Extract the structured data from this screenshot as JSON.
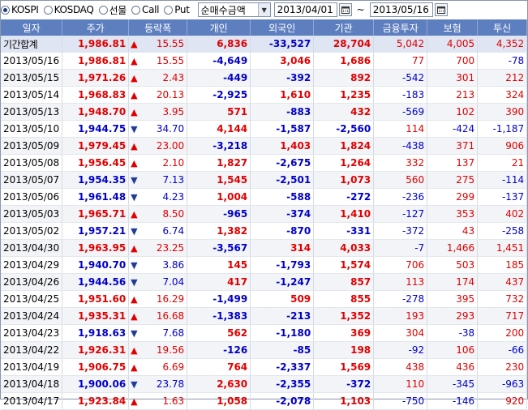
{
  "toolbar": {
    "radios": [
      {
        "label": "KOSPI",
        "selected": true
      },
      {
        "label": "KOSDAQ",
        "selected": false
      },
      {
        "label": "선물",
        "selected": false
      },
      {
        "label": "Call",
        "selected": false
      },
      {
        "label": "Put",
        "selected": false
      }
    ],
    "metric_select": "순매수금액",
    "date_from": "2013/04/01",
    "date_separator": "~",
    "date_to": "2013/05/16"
  },
  "colors": {
    "up": "#e00000",
    "down": "#0000c8",
    "header": "#5e7fbf"
  },
  "table": {
    "headers": [
      "일자",
      "주가",
      "등락폭",
      "개인",
      "외국인",
      "기관",
      "금융투자",
      "보험",
      "투신"
    ],
    "rows": [
      {
        "date": "기간합계",
        "price": "1,986.81",
        "dir": "up",
        "chg": "15.55",
        "ind": "6,836",
        "frn": "-33,527",
        "inst": "28,704",
        "fin": "5,042",
        "ins": "4,005",
        "trust": "4,352"
      },
      {
        "date": "2013/05/16",
        "price": "1,986.81",
        "dir": "up",
        "chg": "15.55",
        "ind": "-4,649",
        "frn": "3,046",
        "inst": "1,686",
        "fin": "77",
        "ins": "700",
        "trust": "-78"
      },
      {
        "date": "2013/05/15",
        "price": "1,971.26",
        "dir": "up",
        "chg": "2.43",
        "ind": "-449",
        "frn": "-392",
        "inst": "892",
        "fin": "-542",
        "ins": "301",
        "trust": "212"
      },
      {
        "date": "2013/05/14",
        "price": "1,968.83",
        "dir": "up",
        "chg": "20.13",
        "ind": "-2,925",
        "frn": "1,610",
        "inst": "1,235",
        "fin": "-183",
        "ins": "213",
        "trust": "324"
      },
      {
        "date": "2013/05/13",
        "price": "1,948.70",
        "dir": "up",
        "chg": "3.95",
        "ind": "571",
        "frn": "-883",
        "inst": "432",
        "fin": "-569",
        "ins": "102",
        "trust": "390"
      },
      {
        "date": "2013/05/10",
        "price": "1,944.75",
        "dir": "down",
        "chg": "34.70",
        "ind": "4,144",
        "frn": "-1,587",
        "inst": "-2,560",
        "fin": "114",
        "ins": "-424",
        "trust": "-1,187"
      },
      {
        "date": "2013/05/09",
        "price": "1,979.45",
        "dir": "up",
        "chg": "23.00",
        "ind": "-3,218",
        "frn": "1,403",
        "inst": "1,824",
        "fin": "-438",
        "ins": "371",
        "trust": "906"
      },
      {
        "date": "2013/05/08",
        "price": "1,956.45",
        "dir": "up",
        "chg": "2.10",
        "ind": "1,827",
        "frn": "-2,675",
        "inst": "1,264",
        "fin": "332",
        "ins": "137",
        "trust": "21"
      },
      {
        "date": "2013/05/07",
        "price": "1,954.35",
        "dir": "down",
        "chg": "7.13",
        "ind": "1,545",
        "frn": "-2,501",
        "inst": "1,073",
        "fin": "560",
        "ins": "275",
        "trust": "-114"
      },
      {
        "date": "2013/05/06",
        "price": "1,961.48",
        "dir": "down",
        "chg": "4.23",
        "ind": "1,004",
        "frn": "-588",
        "inst": "-272",
        "fin": "-236",
        "ins": "299",
        "trust": "-137"
      },
      {
        "date": "2013/05/03",
        "price": "1,965.71",
        "dir": "up",
        "chg": "8.50",
        "ind": "-965",
        "frn": "-374",
        "inst": "1,410",
        "fin": "-127",
        "ins": "353",
        "trust": "402"
      },
      {
        "date": "2013/05/02",
        "price": "1,957.21",
        "dir": "down",
        "chg": "6.74",
        "ind": "1,382",
        "frn": "-870",
        "inst": "-331",
        "fin": "-372",
        "ins": "43",
        "trust": "-258"
      },
      {
        "date": "2013/04/30",
        "price": "1,963.95",
        "dir": "up",
        "chg": "23.25",
        "ind": "-3,567",
        "frn": "314",
        "inst": "4,033",
        "fin": "-7",
        "ins": "1,466",
        "trust": "1,451"
      },
      {
        "date": "2013/04/29",
        "price": "1,940.70",
        "dir": "down",
        "chg": "3.86",
        "ind": "145",
        "frn": "-1,793",
        "inst": "1,574",
        "fin": "706",
        "ins": "503",
        "trust": "185"
      },
      {
        "date": "2013/04/26",
        "price": "1,944.56",
        "dir": "down",
        "chg": "7.04",
        "ind": "417",
        "frn": "-1,247",
        "inst": "857",
        "fin": "113",
        "ins": "174",
        "trust": "437"
      },
      {
        "date": "2013/04/25",
        "price": "1,951.60",
        "dir": "up",
        "chg": "16.29",
        "ind": "-1,499",
        "frn": "509",
        "inst": "855",
        "fin": "-278",
        "ins": "395",
        "trust": "732"
      },
      {
        "date": "2013/04/24",
        "price": "1,935.31",
        "dir": "up",
        "chg": "16.68",
        "ind": "-1,383",
        "frn": "-213",
        "inst": "1,352",
        "fin": "193",
        "ins": "293",
        "trust": "717"
      },
      {
        "date": "2013/04/23",
        "price": "1,918.63",
        "dir": "down",
        "chg": "7.68",
        "ind": "562",
        "frn": "-1,180",
        "inst": "369",
        "fin": "304",
        "ins": "-38",
        "trust": "200"
      },
      {
        "date": "2013/04/22",
        "price": "1,926.31",
        "dir": "up",
        "chg": "19.56",
        "ind": "-126",
        "frn": "-85",
        "inst": "198",
        "fin": "-92",
        "ins": "106",
        "trust": "-66"
      },
      {
        "date": "2013/04/19",
        "price": "1,906.75",
        "dir": "up",
        "chg": "6.69",
        "ind": "764",
        "frn": "-2,337",
        "inst": "1,569",
        "fin": "438",
        "ins": "436",
        "trust": "230"
      },
      {
        "date": "2013/04/18",
        "price": "1,900.06",
        "dir": "down",
        "chg": "23.78",
        "ind": "2,630",
        "frn": "-2,355",
        "inst": "-372",
        "fin": "110",
        "ins": "-345",
        "trust": "-963"
      },
      {
        "date": "2013/04/17",
        "price": "1,923.84",
        "dir": "up",
        "chg": "1.63",
        "ind": "1,058",
        "frn": "-2,078",
        "inst": "1,103",
        "fin": "-750",
        "ins": "-146",
        "trust": "920"
      }
    ]
  }
}
